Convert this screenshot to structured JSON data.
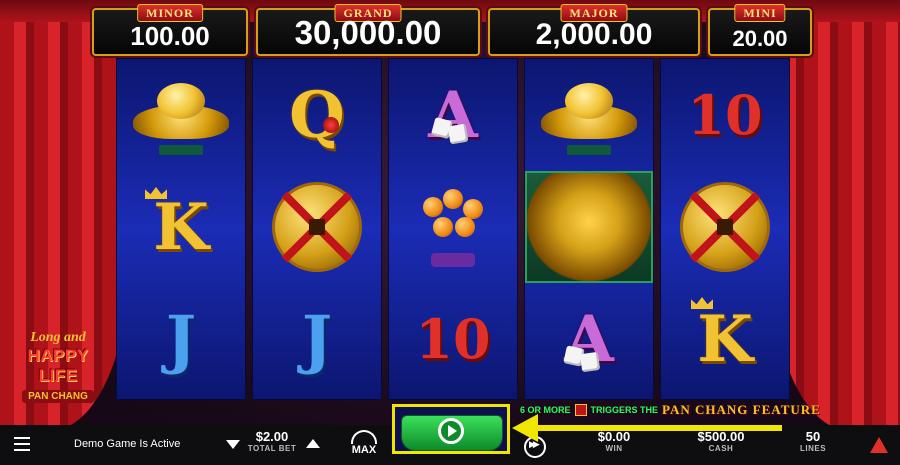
{
  "jackpots": {
    "minor": {
      "label": "MINOR",
      "value": "100.00"
    },
    "grand": {
      "label": "GRAND",
      "value": "30,000.00"
    },
    "major": {
      "label": "MAJOR",
      "value": "2,000.00"
    },
    "mini": {
      "label": "MINI",
      "value": "20.00"
    }
  },
  "reels": [
    [
      "gold-ingot",
      "K",
      "J"
    ],
    [
      "Q",
      "gold-coin",
      "J"
    ],
    [
      "A",
      "orange-tree",
      "10"
    ],
    [
      "gold-ingot",
      "dragon-treasure",
      "A"
    ],
    [
      "10",
      "gold-coin",
      "K"
    ]
  ],
  "symbols": {
    "k": "K",
    "j": "J",
    "q": "Q",
    "a": "A",
    "ten": "10"
  },
  "logo": {
    "line1": "Long and",
    "line2": "HAPPY LIFE",
    "line3": "PAN CHANG"
  },
  "feature_banner": {
    "prefix": "6 OR MORE",
    "middle": "TRIGGERS THE",
    "feature": "PAN CHANG FEATURE"
  },
  "bottom_bar": {
    "demo_text": "Demo Game Is Active",
    "total_bet_value": "$2.00",
    "total_bet_label": "TOTAL BET",
    "max_label": "MAX",
    "win_value": "$0.00",
    "win_label": "WIN",
    "cash_value": "$500.00",
    "cash_label": "CASH",
    "lines_value": "50",
    "lines_label": "LINES"
  },
  "colors": {
    "highlight": "#f1e600",
    "spin_green": "#2bbd4a",
    "reel_blue": "#1b2cb6",
    "curtain_red": "#c0141a"
  }
}
